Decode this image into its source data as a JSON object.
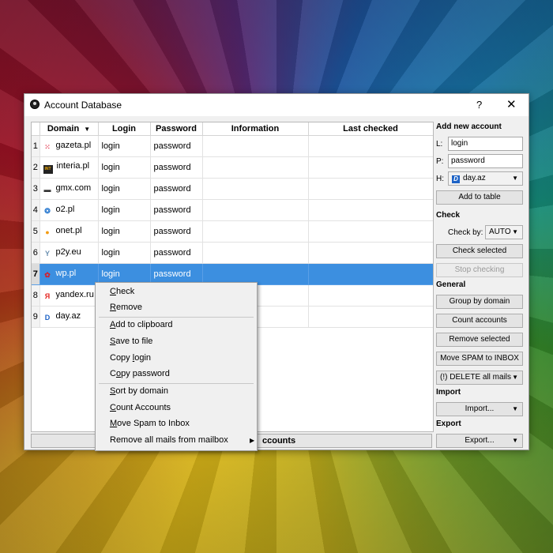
{
  "window": {
    "title": "Account Database",
    "help": "?",
    "close": "✕"
  },
  "table": {
    "columns": [
      "Domain",
      "Login",
      "Password",
      "Information",
      "Last checked"
    ],
    "rows": [
      {
        "num": "1",
        "domain": "gazeta.pl",
        "login": "login",
        "password": "password",
        "icon": "gazeta-icon",
        "icon_char": "⁙",
        "icon_color": "#e2334a"
      },
      {
        "num": "2",
        "domain": "interia.pl",
        "login": "login",
        "password": "password",
        "icon": "interia-icon",
        "icon_char": "INT",
        "icon_color": "#f2a900"
      },
      {
        "num": "3",
        "domain": "gmx.com",
        "login": "login",
        "password": "password",
        "icon": "gmx-icon",
        "icon_char": "▬",
        "icon_color": "#333333"
      },
      {
        "num": "4",
        "domain": "o2.pl",
        "login": "login",
        "password": "password",
        "icon": "o2-icon",
        "icon_char": "❂",
        "icon_color": "#2f7dd1"
      },
      {
        "num": "5",
        "domain": "onet.pl",
        "login": "login",
        "password": "password",
        "icon": "onet-icon",
        "icon_char": "●",
        "icon_color": "#f39c12"
      },
      {
        "num": "6",
        "domain": "p2y.eu",
        "login": "login",
        "password": "password",
        "icon": "p2y-icon",
        "icon_char": "Y",
        "icon_color": "#6a8fb0"
      },
      {
        "num": "7",
        "domain": "wp.pl",
        "login": "login",
        "password": "password",
        "icon": "wp-icon",
        "icon_char": "✿",
        "icon_color": "#d1202f",
        "selected": true
      },
      {
        "num": "8",
        "domain": "yandex.ru",
        "login": "",
        "password": "",
        "icon": "yandex-icon",
        "icon_char": "Я",
        "icon_color": "#e52620"
      },
      {
        "num": "9",
        "domain": "day.az",
        "login": "",
        "password": "",
        "icon": "dayaz-icon",
        "icon_char": "D",
        "icon_color": "#1d63c6"
      }
    ]
  },
  "bottom_button_visible_text": "ccounts",
  "panel": {
    "add_new_account": "Add new account",
    "login_label": "L:",
    "login_value": "login",
    "password_label": "P:",
    "password_value": "password",
    "host_label": "H:",
    "host_value": "day.az",
    "add_to_table": "Add to table",
    "check": "Check",
    "check_by_label": "Check by:",
    "check_by_value": "AUTO",
    "check_selected": "Check selected",
    "stop_checking": "Stop checking",
    "general": "General",
    "group_by_domain": "Group by domain",
    "count_accounts": "Count accounts",
    "remove_selected": "Remove selected",
    "move_spam": "Move SPAM to INBOX",
    "delete_all_mails": "(!) DELETE all mails",
    "import_header": "Import",
    "import_btn": "Import...",
    "export_header": "Export",
    "export_btn": "Export..."
  },
  "context_menu": {
    "check_u": "C",
    "check_rest": "heck",
    "remove_u": "R",
    "remove_rest": "emove",
    "add_clip_u": "A",
    "add_clip_rest": "dd to clipboard",
    "save_u": "S",
    "save_rest": "ave to file",
    "copy_login_pre": "Copy ",
    "copy_login_u": "l",
    "copy_login_rest": "ogin",
    "copy_pass_pre": "C",
    "copy_pass_u": "o",
    "copy_pass_rest": "py password",
    "sort_u": "S",
    "sort_rest": "ort by domain",
    "count_u": "C",
    "count_rest": "ount Accounts",
    "move_u": "M",
    "move_rest": "ove Spam to Inbox",
    "remove_all": "Remove all mails from mailbox"
  }
}
